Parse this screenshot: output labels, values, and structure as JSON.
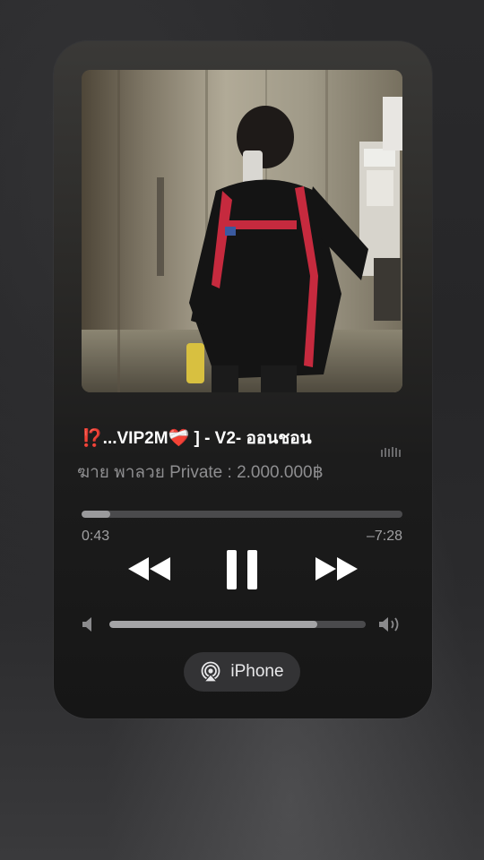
{
  "now_playing": {
    "title_prefix": "⁉️",
    "title_main": "...VIP2M❤️‍🩹 ] - V2- ออนชอน",
    "subtitle": "ฆาย พาลวย  Private : 2.000.000฿",
    "elapsed": "0:43",
    "remaining": "–7:28",
    "progress_fraction": 0.09
  },
  "volume": {
    "level_fraction": 0.81
  },
  "output": {
    "device_label": "iPhone"
  },
  "icons": {
    "rewind": "rewind-icon",
    "pause": "pause-icon",
    "fast_forward": "fast-forward-icon",
    "volume_low": "speaker-low-icon",
    "volume_high": "speaker-high-icon",
    "airplay": "airplay-audio-icon",
    "waveform": "waveform-icon"
  },
  "colors": {
    "accent_red": "#e5233a",
    "text_primary": "#ffffff",
    "text_secondary": "#8e8e90"
  }
}
